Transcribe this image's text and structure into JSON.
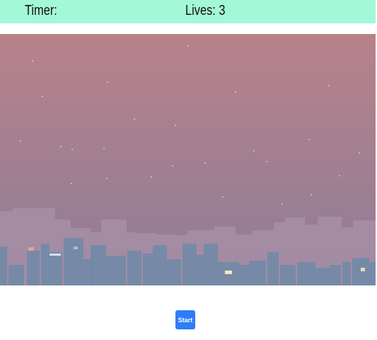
{
  "hud": {
    "timer_label": "Timer:",
    "timer_value": "",
    "lives_label": "Lives:",
    "lives_value": "3",
    "background_color": "#a3f8d8"
  },
  "game": {
    "background": {
      "sky_top_color": "#b88289",
      "sky_bottom_color": "#8d7d98",
      "far_buildings_color": "#a58ea4",
      "near_buildings_color": "#6f8aa8"
    }
  },
  "controls": {
    "start_label": "Start",
    "start_color": "#2f7cf6"
  }
}
